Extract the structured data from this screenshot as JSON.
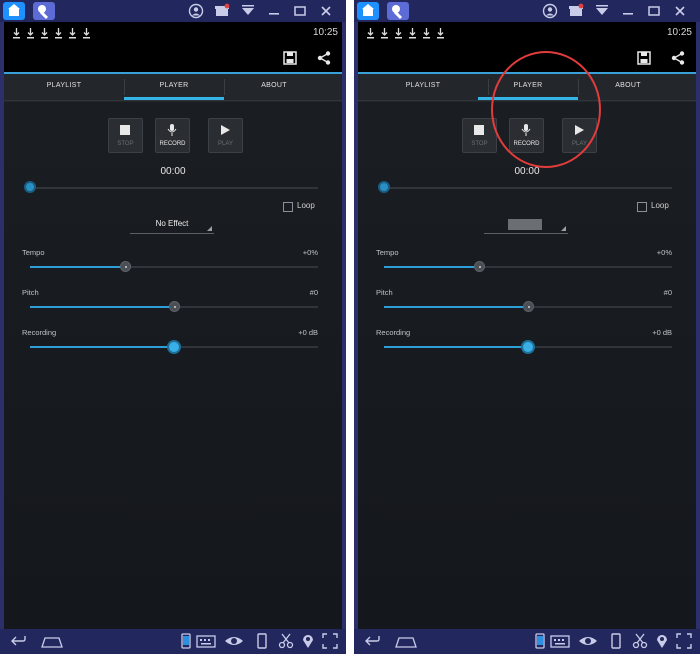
{
  "clock": "10:25",
  "tabs": {
    "playlist": "PLAYLIST",
    "player": "PLAYER",
    "about": "ABOUT"
  },
  "controls": {
    "stop": "STOP",
    "record": "RECORD",
    "play": "PLAY"
  },
  "time": "00:00",
  "loop_label": "Loop",
  "effect_left": "No Effect",
  "params": {
    "tempo": {
      "label": "Tempo",
      "value": "+0%",
      "level": 0.33
    },
    "pitch": {
      "label": "Pitch",
      "value": "#0",
      "level": 0.5
    },
    "recording": {
      "label": "Recording",
      "value": "+0 dB",
      "level": 0.5
    }
  },
  "colors": {
    "accent": "#33b5e5",
    "annotation": "#e23c3c",
    "emulator_frame": "#2b2f6b"
  },
  "icons": {
    "titlebar": [
      "home-icon",
      "app-icon",
      "account-icon",
      "notification-icon",
      "wifi-icon",
      "minimize-icon",
      "maximize-icon",
      "close-icon"
    ],
    "actionbar": [
      "save-icon",
      "share-icon"
    ],
    "navbar": [
      "back-icon",
      "home-nav-icon",
      "phone-icon",
      "keyboard-icon",
      "eye-icon",
      "rotate-icon",
      "scissors-icon",
      "location-icon",
      "fullscreen-icon"
    ]
  }
}
